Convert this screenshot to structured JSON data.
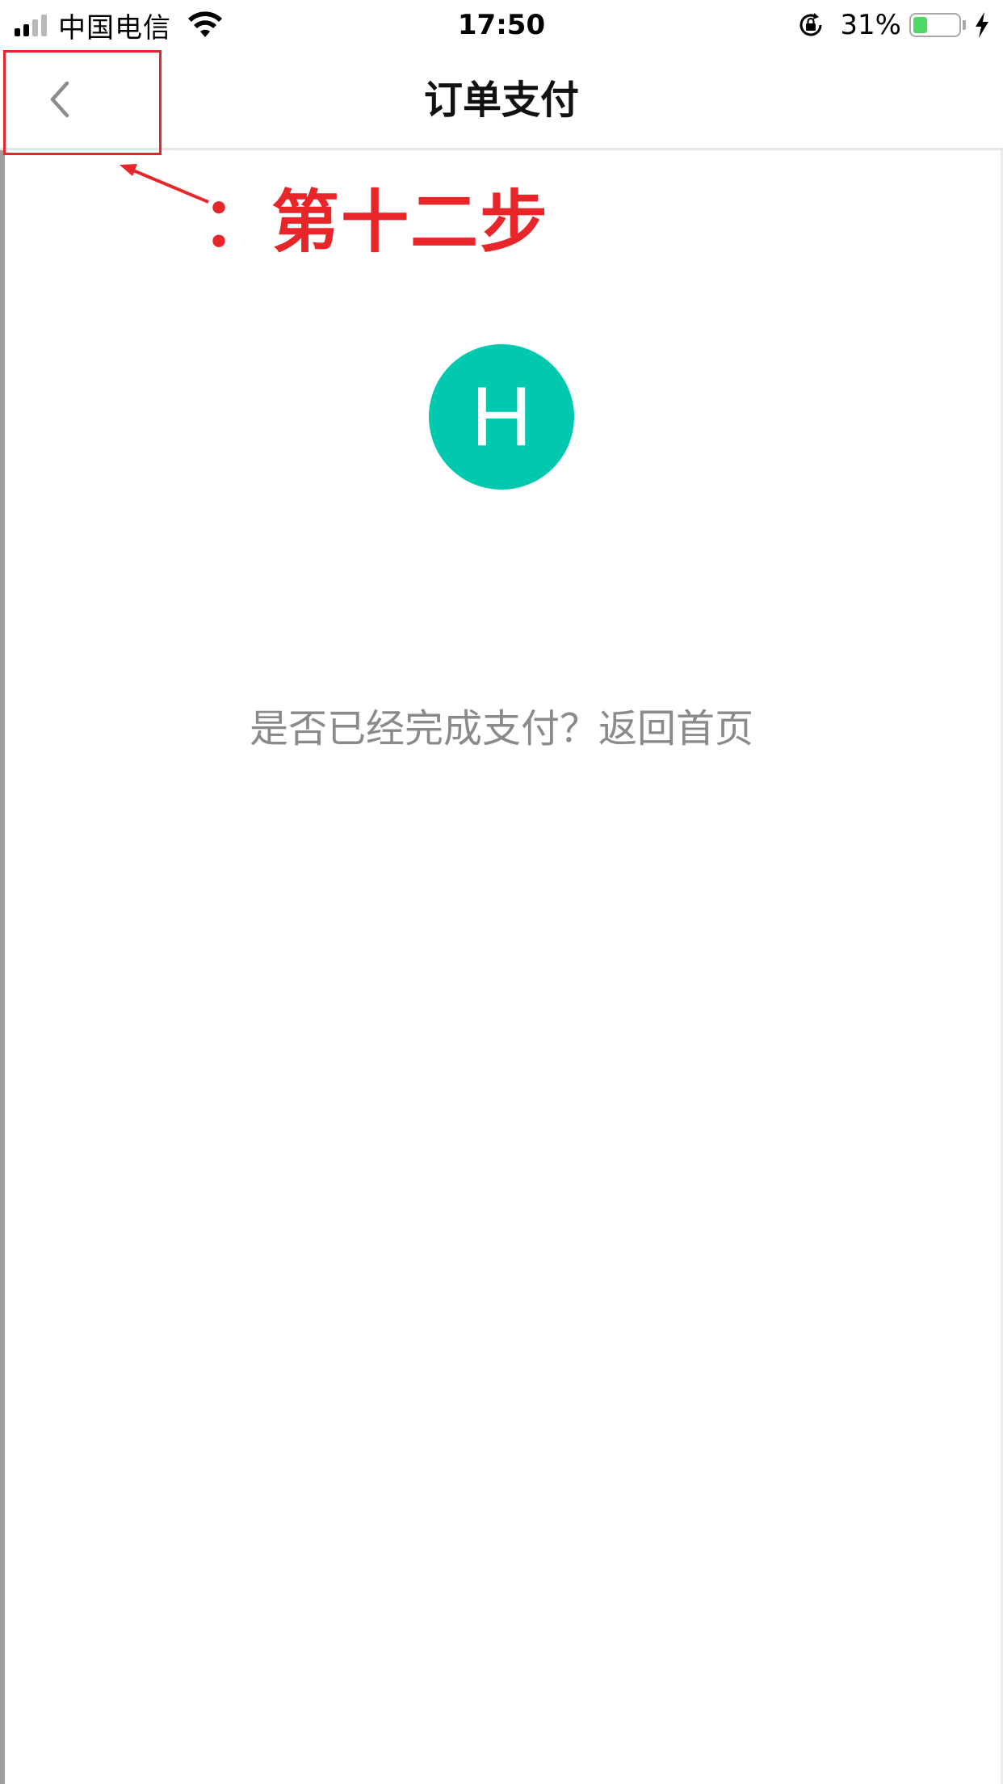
{
  "status_bar": {
    "carrier": "中国电信",
    "time": "17:50",
    "battery_percent": "31%",
    "battery_level": 0.31,
    "icons": [
      "signal-icon",
      "wifi-icon",
      "rotation-lock-icon",
      "battery-icon",
      "charging-bolt-icon"
    ]
  },
  "nav": {
    "title": "订单支付",
    "back_icon": "chevron-left-icon"
  },
  "annotation": {
    "label": "：第十二步",
    "color": "#e8262a"
  },
  "main": {
    "avatar_letter": "H",
    "avatar_color": "#00c9b0",
    "question": "是否已经完成支付？返回首页"
  }
}
